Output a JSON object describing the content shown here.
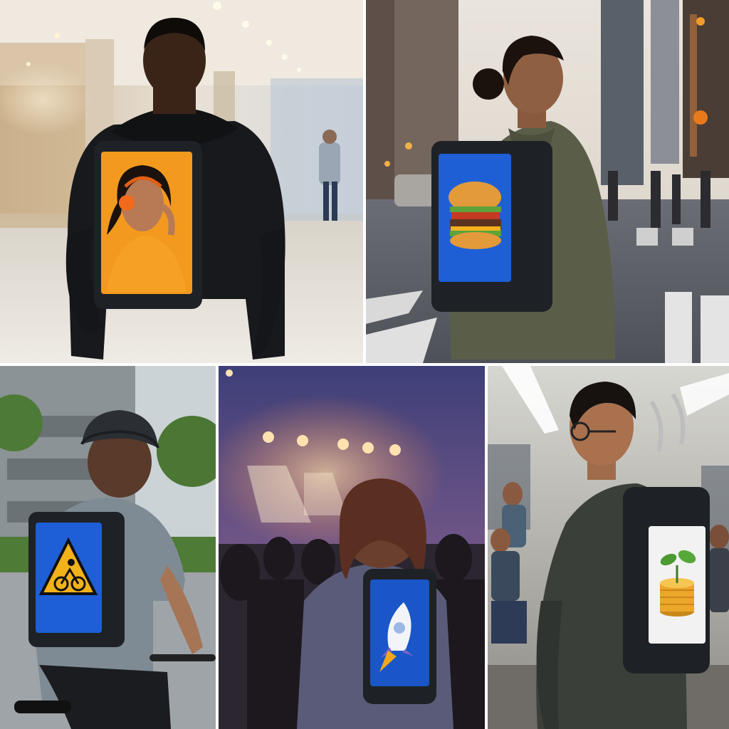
{
  "panels": [
    {
      "id": "mall",
      "scene": "shopping-mall",
      "screen_content": "woman-with-headphones",
      "screen_color": "#f39a1e"
    },
    {
      "id": "street",
      "scene": "city-crosswalk",
      "screen_content": "burger-icon",
      "screen_color": "#1f5fd6"
    },
    {
      "id": "cyclist",
      "scene": "road-cycling",
      "screen_content": "cyclist-warning-icon",
      "screen_color": "#1e5fd8"
    },
    {
      "id": "concert",
      "scene": "concert-crowd",
      "screen_content": "rocket-icon",
      "screen_color": "#1a56c8"
    },
    {
      "id": "subway",
      "scene": "subway-train",
      "screen_content": "coin-stack-plant-icon",
      "screen_color": "#f2f2f2"
    }
  ],
  "colors": {
    "divider": "#ffffff",
    "backpack": "#1e2226",
    "screen_orange": "#f39a1e",
    "screen_blue": "#1f5fd6",
    "warning_yellow": "#f2b21a"
  }
}
